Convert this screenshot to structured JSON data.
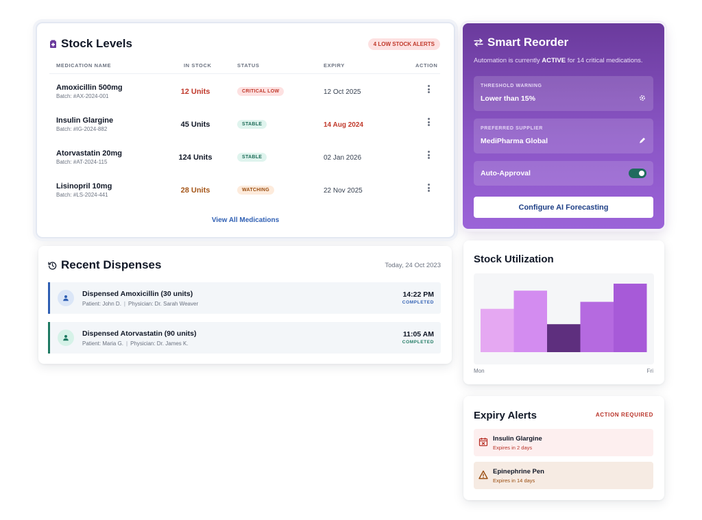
{
  "stock_levels": {
    "title": "Stock Levels",
    "alert_badge": "4 LOW STOCK ALERTS",
    "columns": [
      "MEDICATION NAME",
      "IN STOCK",
      "STATUS",
      "EXPIRY",
      "ACTION"
    ],
    "rows": [
      {
        "name": "Amoxicillin 500mg",
        "batch": "Batch: #AX-2024-001",
        "stock": "12 Units",
        "stock_color": "#c0392b",
        "status": "CRITICAL LOW",
        "status_type": "critical",
        "expiry": "12 Oct 2025",
        "expiry_color": "#374151"
      },
      {
        "name": "Insulin Glargine",
        "batch": "Batch: #IG-2024-882",
        "stock": "45 Units",
        "stock_color": "#111827",
        "status": "STABLE",
        "status_type": "stable",
        "expiry": "14 Aug 2024",
        "expiry_color": "#c0392b"
      },
      {
        "name": "Atorvastatin 20mg",
        "batch": "Batch: #AT-2024-115",
        "stock": "124 Units",
        "stock_color": "#111827",
        "status": "STABLE",
        "status_type": "stable",
        "expiry": "02 Jan 2026",
        "expiry_color": "#374151"
      },
      {
        "name": "Lisinopril 10mg",
        "batch": "Batch: #LS-2024-441",
        "stock": "28 Units",
        "stock_color": "#a5571a",
        "status": "WATCHING",
        "status_type": "watch",
        "expiry": "22 Nov 2025",
        "expiry_color": "#374151"
      }
    ],
    "view_all": "View All Medications"
  },
  "smart_reorder": {
    "title": "Smart Reorder",
    "note_prefix": "Automation is currently ",
    "note_state": "ACTIVE",
    "note_suffix": " for 14 critical medications.",
    "threshold_label": "THRESHOLD WARNING",
    "threshold_value": "Lower than 15%",
    "supplier_label": "PREFERRED SUPPLIER",
    "supplier_value": "MediPharma Global",
    "auto_approval_label": "Auto-Approval",
    "auto_approval_on": true,
    "configure_button": "Configure AI Forecasting"
  },
  "recent_dispenses": {
    "title": "Recent Dispenses",
    "date": "Today, 24 Oct 2023",
    "items": [
      {
        "title": "Dispensed Amoxicillin (30 units)",
        "patient": "Patient: John D.",
        "physician": "Physician: Dr. Sarah Weaver",
        "time": "14:22 PM",
        "status": "COMPLETED",
        "accent": "#2f5fb3"
      },
      {
        "title": "Dispensed Atorvastatin (90 units)",
        "patient": "Patient: Maria G.",
        "physician": "Physician: Dr. James K.",
        "time": "11:05 AM",
        "status": "COMPLETED",
        "accent": "#1f7a63"
      }
    ]
  },
  "stock_utilization": {
    "title": "Stock Utilization",
    "x_start": "Mon",
    "x_end": "Fri"
  },
  "chart_data": {
    "type": "bar",
    "title": "Stock Utilization",
    "categories": [
      "Mon",
      "",
      "",
      "",
      "Fri"
    ],
    "values": [
      0.62,
      0.88,
      0.4,
      0.72,
      0.98
    ],
    "colors": [
      "#e5a8f2",
      "#d38cf0",
      "#5e2f7e",
      "#b56ae0",
      "#a75ad8"
    ],
    "ylim": [
      0,
      1
    ],
    "grid": false
  },
  "expiry_alerts": {
    "title": "Expiry Alerts",
    "action_label": "ACTION REQUIRED",
    "items": [
      {
        "name": "Insulin Glargine",
        "sub": "Expires in 2 days",
        "icon": "calendar-x-icon"
      },
      {
        "name": "Epinephrine Pen",
        "sub": "Expires in 14 days",
        "icon": "warning-icon"
      }
    ]
  }
}
